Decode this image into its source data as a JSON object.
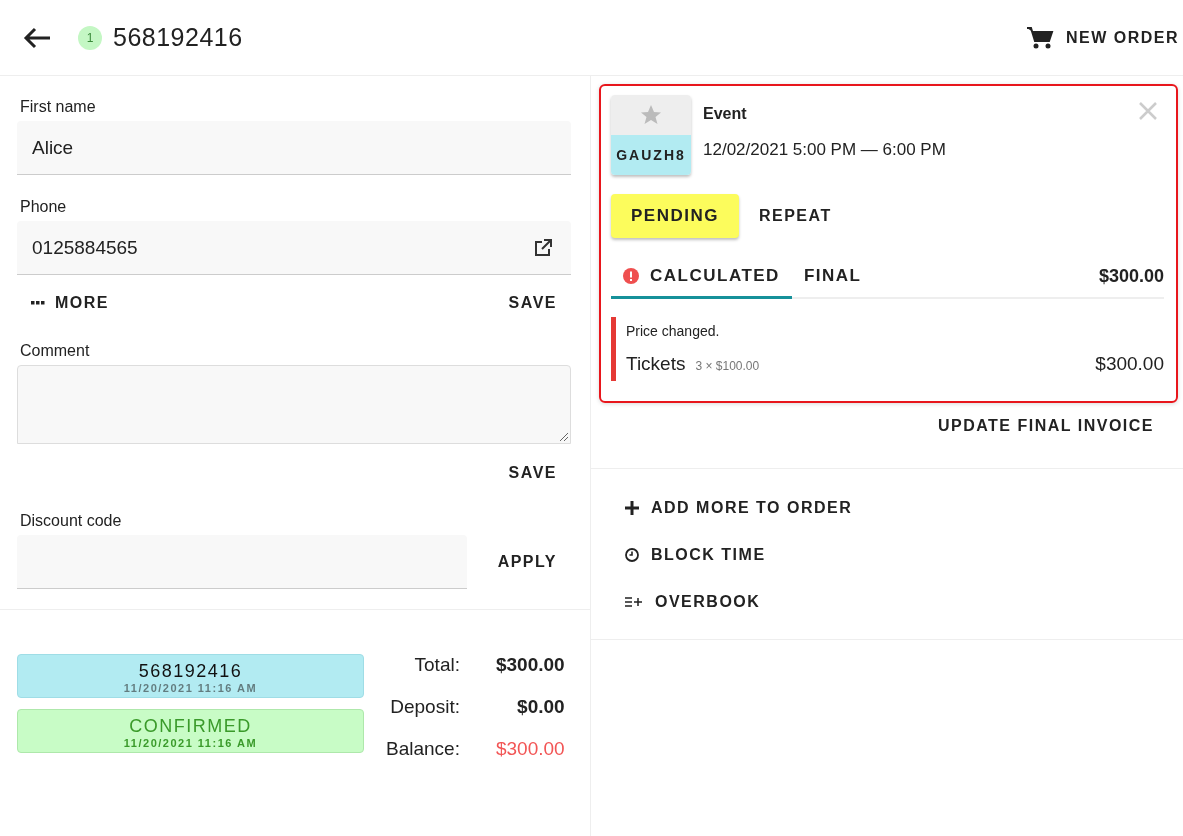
{
  "header": {
    "badge": "1",
    "order_number": "568192416",
    "new_order": "NEW ORDER"
  },
  "form": {
    "fields": [
      {
        "label": "First name",
        "value": "Alice",
        "kind": "text"
      },
      {
        "label": "Phone",
        "value": "0125884565",
        "kind": "phone"
      }
    ],
    "more": "MORE",
    "save": "SAVE",
    "comment": {
      "label": "Comment"
    },
    "comment_save": "SAVE",
    "discount": {
      "label": "Discount code",
      "apply": "APPLY"
    }
  },
  "status_chips": [
    {
      "title": "568192416",
      "timestamp": "11/20/2021 11:16 AM",
      "kind": "order"
    },
    {
      "title": "CONFIRMED",
      "timestamp": "11/20/2021 11:16 AM",
      "kind": "status"
    }
  ],
  "totals": [
    {
      "label": "Total:",
      "value": "$300.00",
      "due": false
    },
    {
      "label": "Deposit:",
      "value": "$0.00",
      "due": false
    },
    {
      "label": "Balance:",
      "value": "$300.00",
      "due": true
    }
  ],
  "booking": {
    "selected": true,
    "code": "GAUZH8",
    "title": "Event",
    "time": "12/02/2021 5:00 PM — 6:00 PM",
    "status": "PENDING",
    "repeat": "REPEAT",
    "tabs": [
      {
        "label": "CALCULATED",
        "selected": true,
        "warning": true
      },
      {
        "label": "FINAL",
        "selected": false,
        "warning": false
      }
    ],
    "total": "$300.00",
    "alert": "Price changed.",
    "line": {
      "name": "Tickets",
      "detail": "3 × $100.00",
      "amount": "$300.00"
    },
    "update": "UPDATE FINAL INVOICE"
  },
  "actions": [
    {
      "label": "ADD MORE TO ORDER",
      "kind": "add"
    },
    {
      "label": "BLOCK TIME",
      "kind": "clock"
    },
    {
      "label": "OVERBOOK",
      "kind": "overbook"
    }
  ]
}
